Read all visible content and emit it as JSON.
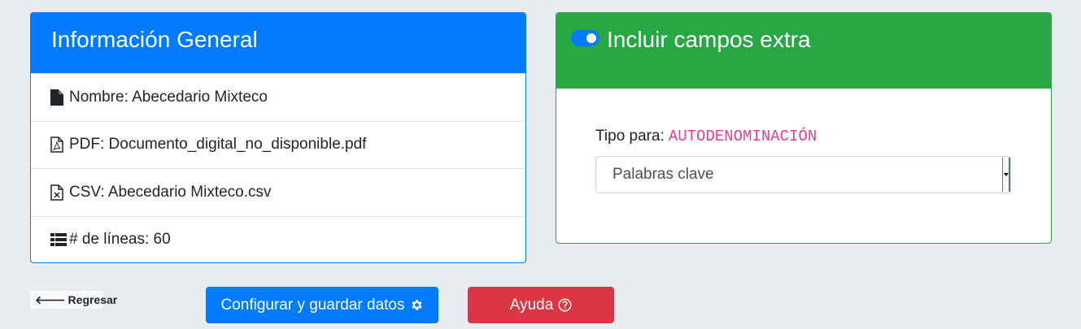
{
  "info_card": {
    "title": "Información General",
    "items": [
      {
        "icon": "file-icon",
        "text": "Nombre: Abecedario Mixteco"
      },
      {
        "icon": "file-pdf-icon",
        "text": "PDF: Documento_digital_no_disponible.pdf"
      },
      {
        "icon": "file-csv-icon",
        "text": "CSV: Abecedario Mixteco.csv"
      },
      {
        "icon": "list-icon",
        "text": "# de líneas: 60"
      }
    ]
  },
  "extra_card": {
    "title": "Incluir campos extra",
    "toggle_on": true,
    "type_label": "Tipo para:",
    "type_value": "AUTODENOMINACIÓN",
    "select_value": "Palabras clave"
  },
  "actions": {
    "back_label": "Regresar",
    "save_label": "Configurar y guardar datos",
    "help_label": "Ayuda"
  },
  "colors": {
    "primary": "#007bff",
    "success": "#28a745",
    "danger": "#dc3545",
    "code": "#e83e8c"
  }
}
